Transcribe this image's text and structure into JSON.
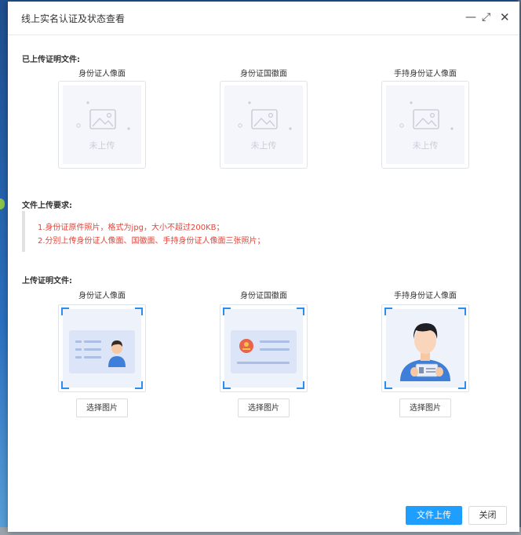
{
  "dialog": {
    "title": "线上实名认证及状态查看",
    "controls": {
      "minimize": "—",
      "maximize": "⤢",
      "close": "✕"
    }
  },
  "uploaded_section": {
    "heading": "已上传证明文件:",
    "items": [
      {
        "label": "身份证人像面",
        "status": "未上传"
      },
      {
        "label": "身份证国徽面",
        "status": "未上传"
      },
      {
        "label": "手持身份证人像面",
        "status": "未上传"
      }
    ]
  },
  "requirements": {
    "heading": "文件上传要求:",
    "lines": [
      "1.身份证原件照片，格式为jpg，大小不超过200KB；",
      "2.分别上传身份证人像面、国徽面、手持身份证人像面三张照片；"
    ],
    "color": "#e0453b"
  },
  "upload_section": {
    "heading": "上传证明文件:",
    "items": [
      {
        "label": "身份证人像面",
        "button": "选择图片"
      },
      {
        "label": "身份证国徽面",
        "button": "选择图片"
      },
      {
        "label": "手持身份证人像面",
        "button": "选择图片"
      }
    ]
  },
  "footer": {
    "upload_button": "文件上传",
    "close_button": "关闭",
    "accent": "#1e9fff"
  }
}
